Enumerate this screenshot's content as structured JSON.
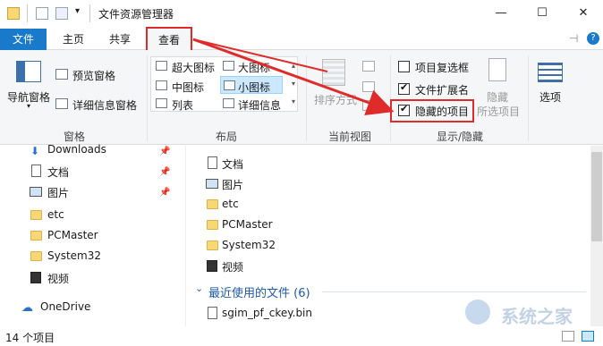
{
  "title": "文件资源管理器",
  "window_controls": {
    "minimize": "—",
    "maximize": "☐",
    "close": "✕"
  },
  "tabs": {
    "file": "文件",
    "home": "主页",
    "share": "共享",
    "view": "查看"
  },
  "ribbon": {
    "pane": {
      "nav_pane": "导航窗格",
      "preview_pane": "预览窗格",
      "details_pane": "详细信息窗格",
      "group_label": "窗格"
    },
    "layout": {
      "extra_large_icons": "超大图标",
      "large_icons": "大图标",
      "medium_icons": "中图标",
      "small_icons": "小图标",
      "list": "列表",
      "details": "详细信息",
      "group_label": "布局"
    },
    "current_view": {
      "sort_by": "排序方式",
      "group_label": "当前视图"
    },
    "show_hide": {
      "item_checkboxes": "项目复选框",
      "item_checkboxes_checked": false,
      "file_extensions": "文件扩展名",
      "file_extensions_checked": true,
      "hidden_items": "隐藏的项目",
      "hidden_items_checked": true,
      "hide_selected": "隐藏",
      "hide_selected_2": "所选项目",
      "group_label": "显示/隐藏"
    },
    "options": "选项"
  },
  "nav_items": [
    "Downloads",
    "文档",
    "图片",
    "etc",
    "PCMaster",
    "System32",
    "视频",
    "OneDrive"
  ],
  "content_items": [
    "文档",
    "图片",
    "etc",
    "PCMaster",
    "System32",
    "视频"
  ],
  "recent_group": "最近使用的文件 (6)",
  "recent_items": [
    "sgim_pf_ckey.bin"
  ],
  "status": "14 个项目",
  "watermark": "系统之家",
  "colors": {
    "accent": "#1979ca",
    "highlight": "#e02b2b"
  }
}
